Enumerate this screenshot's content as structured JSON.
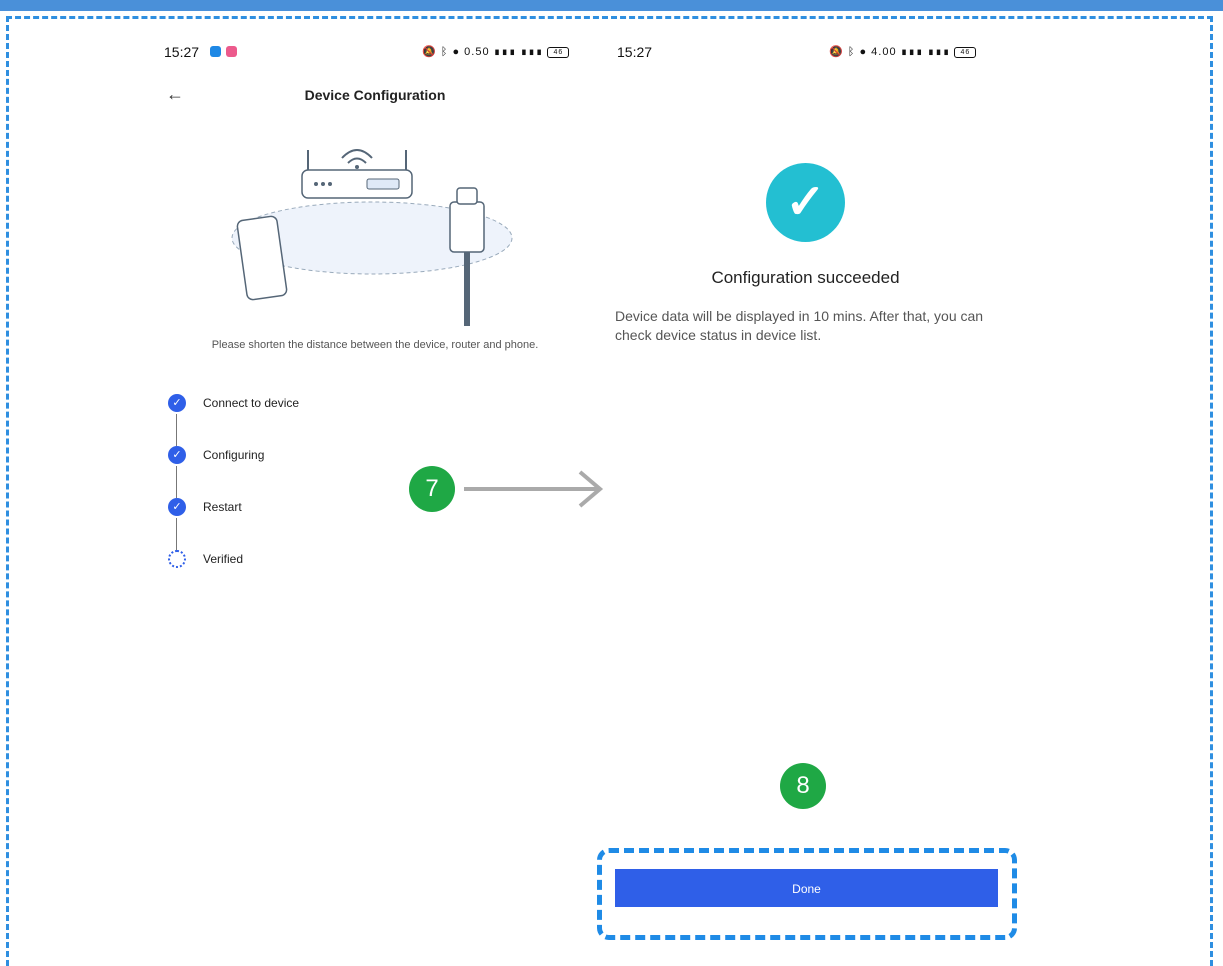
{
  "left_screen": {
    "status": {
      "time": "15:27",
      "net_speed": "0.50",
      "battery": "46"
    },
    "title": "Device Configuration",
    "hint": "Please shorten the distance between the device, router and phone.",
    "steps": [
      {
        "label": "Connect to device",
        "state": "done"
      },
      {
        "label": "Configuring",
        "state": "done"
      },
      {
        "label": "Restart",
        "state": "done"
      },
      {
        "label": "Verified",
        "state": "loading"
      }
    ]
  },
  "right_screen": {
    "status": {
      "time": "15:27",
      "net_speed": "4.00",
      "battery": "46"
    },
    "success_title": "Configuration succeeded",
    "success_desc": "Device data will be displayed in 10 mins. After that, you can check device status in device list.",
    "done_label": "Done"
  },
  "annotations": {
    "step_7": "7",
    "step_8": "8"
  },
  "colors": {
    "accent": "#2f5fe8",
    "success": "#23bfd2",
    "badge": "#1fa845",
    "highlight": "#1f8be6"
  }
}
